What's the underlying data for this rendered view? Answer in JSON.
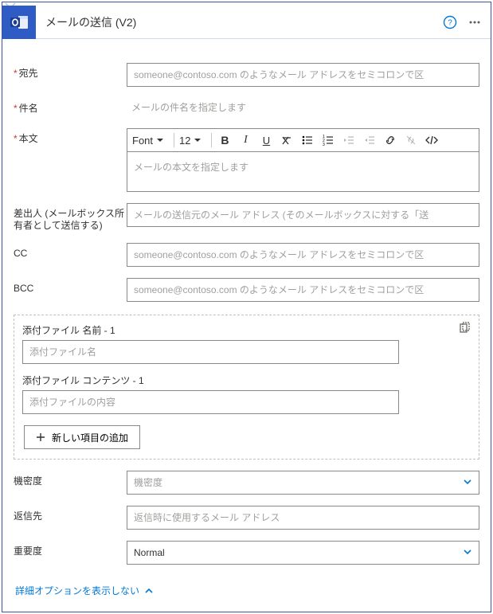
{
  "header": {
    "title": "メールの送信 (V2)"
  },
  "to": {
    "label": "宛先",
    "placeholder": "someone@contoso.com のようなメール アドレスをセミコロンで区"
  },
  "subject": {
    "label": "件名",
    "placeholder": "メールの件名を指定します"
  },
  "body": {
    "label": "本文",
    "font": "Font",
    "size": "12",
    "placeholder": "メールの本文を指定します"
  },
  "from": {
    "label": "差出人 (メールボックス所有者として送信する)",
    "placeholder": "メールの送信元のメール アドレス (そのメールボックスに対する「送"
  },
  "cc": {
    "label": "CC",
    "placeholder": "someone@contoso.com のようなメール アドレスをセミコロンで区"
  },
  "bcc": {
    "label": "BCC",
    "placeholder": "someone@contoso.com のようなメール アドレスをセミコロンで区"
  },
  "attach": {
    "name_label": "添付ファイル 名前 - 1",
    "name_placeholder": "添付ファイル名",
    "content_label": "添付ファイル コンテンツ - 1",
    "content_placeholder": "添付ファイルの内容",
    "add_label": "新しい項目の追加"
  },
  "sensitivity": {
    "label": "機密度",
    "placeholder": "機密度"
  },
  "replyto": {
    "label": "返信先",
    "placeholder": "返信時に使用するメール アドレス"
  },
  "importance": {
    "label": "重要度",
    "value": "Normal"
  },
  "footer": {
    "hide_advanced": "詳細オプションを表示しない"
  }
}
